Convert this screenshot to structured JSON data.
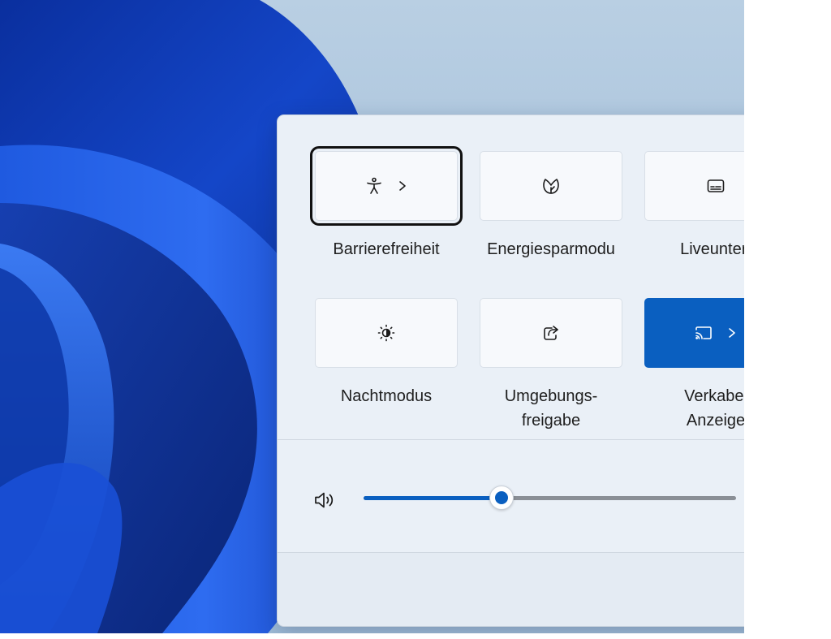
{
  "quick_settings": {
    "tiles": [
      {
        "label": "Barrierefreiheit",
        "icon": "accessibility-icon",
        "has_chevron": true,
        "active": false,
        "focused": true
      },
      {
        "label": "Energiesparmodu",
        "icon": "energy-saver-leaf-icon",
        "has_chevron": false,
        "active": false,
        "focused": false
      },
      {
        "label": "Liveuntert",
        "icon": "live-captions-icon",
        "has_chevron": false,
        "active": false,
        "focused": false
      },
      {
        "label": "Nachtmodus",
        "icon": "night-light-icon",
        "has_chevron": false,
        "active": false,
        "focused": false
      },
      {
        "label": "Umgebungs-\nfreigabe",
        "icon": "nearby-share-icon",
        "has_chevron": false,
        "active": false,
        "focused": false
      },
      {
        "label": "Verkabel\nAnzeige",
        "icon": "cast-icon",
        "has_chevron": true,
        "active": true,
        "focused": false
      }
    ],
    "volume": {
      "icon": "speaker-volume-icon",
      "level": 0.37
    }
  },
  "colors": {
    "accent": "#0a5fc0",
    "flyout_bg": "#eaf0f7",
    "tile_bg": "#f7f9fc",
    "slider_track": "#8a8f96"
  }
}
